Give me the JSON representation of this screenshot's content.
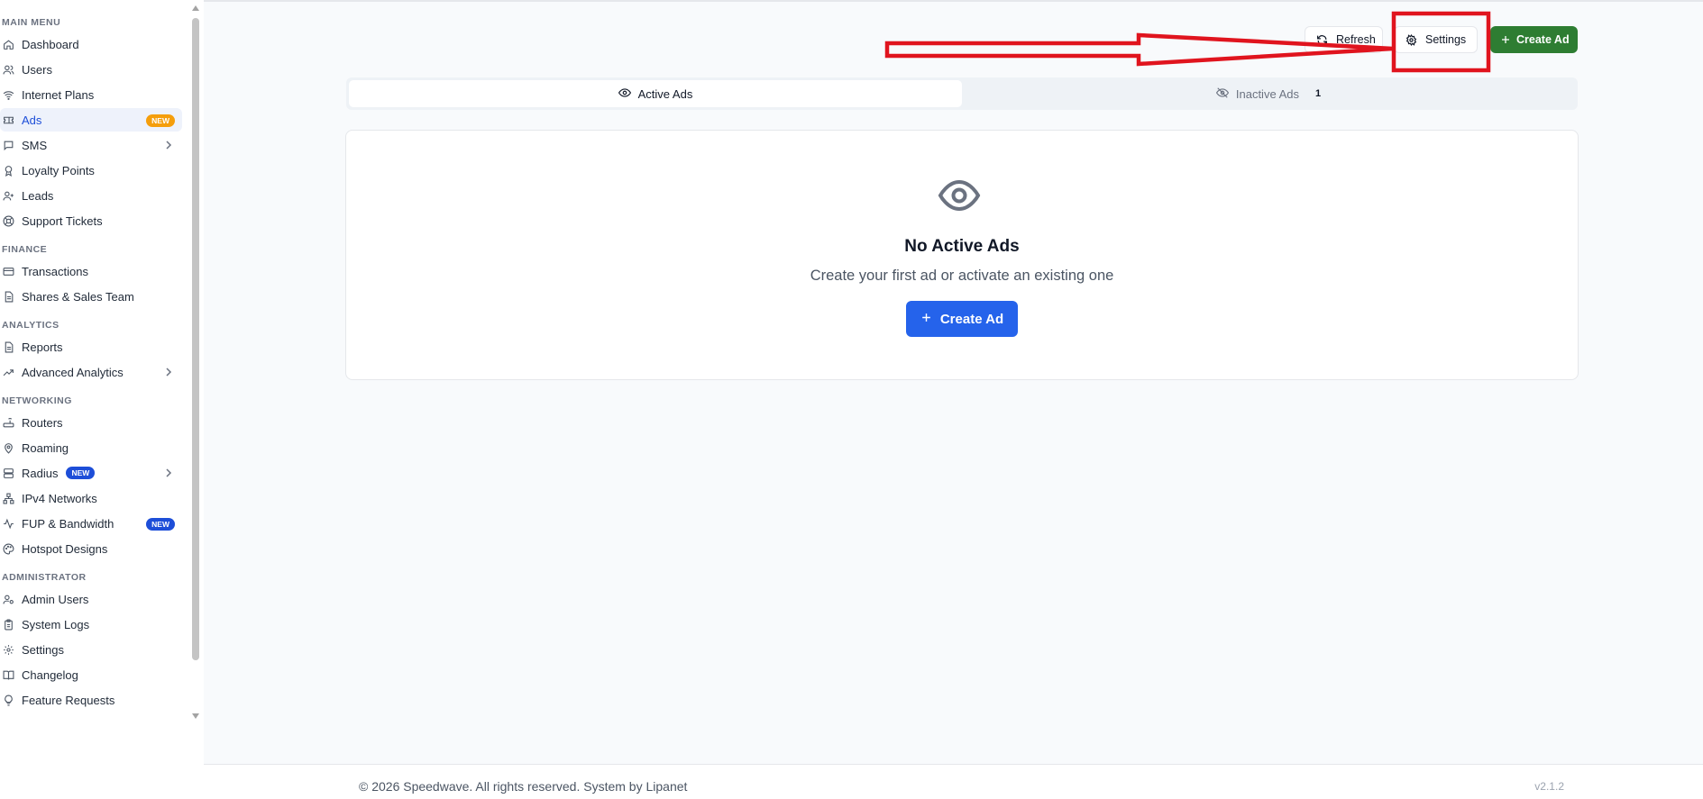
{
  "sidebar": {
    "sections": {
      "main": "MAIN MENU",
      "finance": "FINANCE",
      "analytics": "ANALYTICS",
      "networking": "NETWORKING",
      "administrator": "ADMINISTRATOR"
    },
    "items": {
      "dashboard": "Dashboard",
      "users": "Users",
      "internet_plans": "Internet Plans",
      "ads": "Ads",
      "ads_badge": "NEW",
      "sms": "SMS",
      "loyalty_points": "Loyalty Points",
      "leads": "Leads",
      "support_tickets": "Support Tickets",
      "transactions": "Transactions",
      "shares_sales_team": "Shares & Sales Team",
      "reports": "Reports",
      "advanced_analytics": "Advanced Analytics",
      "routers": "Routers",
      "roaming": "Roaming",
      "radius": "Radius",
      "radius_badge": "NEW",
      "ipv4_networks": "IPv4 Networks",
      "fup_bandwidth": "FUP & Bandwidth",
      "fup_badge": "NEW",
      "hotspot_designs": "Hotspot Designs",
      "admin_users": "Admin Users",
      "system_logs": "System Logs",
      "settings": "Settings",
      "changelog": "Changelog",
      "feature_requests": "Feature Requests"
    }
  },
  "toolbar": {
    "refresh": "Refresh",
    "settings": "Settings",
    "create_ad": "Create Ad"
  },
  "tabs": {
    "active": "Active Ads",
    "inactive": "Inactive Ads",
    "inactive_count": "1"
  },
  "empty_state": {
    "title": "No Active Ads",
    "subtitle": "Create your first ad or activate an existing one",
    "cta": "Create Ad"
  },
  "footer": {
    "copyright": "© 2026 Speedwave. All rights reserved. System by Lipanet",
    "version": "v2.1.2"
  },
  "colors": {
    "primary_blue": "#2563eb",
    "create_green": "#2e7d32",
    "badge_orange": "#f59e0b",
    "badge_blue": "#1d4ed8",
    "annotation_red": "#e0141e"
  }
}
